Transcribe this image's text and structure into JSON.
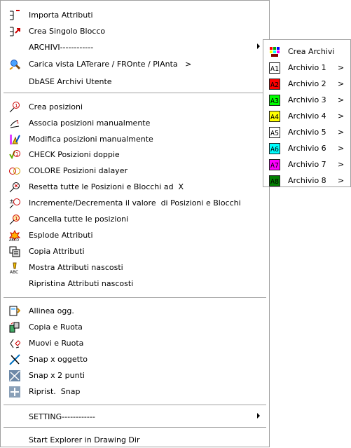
{
  "menu": {
    "items": [
      {
        "label": "Importa Attributi",
        "icon": "import-attributes-icon"
      },
      {
        "label": "Crea Singolo Blocco",
        "icon": "create-block-icon"
      },
      {
        "label": "ARCHIVI------------",
        "submenu": true
      },
      {
        "label": "Carica vista LATerare / FROnte / PIAnta   >",
        "icon": "load-view-icon"
      },
      {
        "label": "DbASE Archivi Utente"
      },
      {
        "label": "Crea posizioni",
        "icon": "create-positions-icon"
      },
      {
        "label": "Associa posizioni manualmente",
        "icon": "associate-positions-icon"
      },
      {
        "label": "Modifica posizioni manualmente",
        "icon": "edit-positions-icon"
      },
      {
        "label": "CHECK Posizioni doppie",
        "icon": "check-duplicates-icon"
      },
      {
        "label": "COLORE Posizioni dalayer",
        "icon": "color-positions-icon"
      },
      {
        "label": "Resetta tutte le Posizioni e Blocchi ad  X",
        "icon": "reset-positions-icon"
      },
      {
        "label": "Incremente/Decrementa il valore  di Posizioni e Blocchi",
        "icon": "increment-icon"
      },
      {
        "label": "Cancella tutte le posizioni",
        "icon": "delete-positions-icon"
      },
      {
        "label": "Esplode Attributi",
        "icon": "explode-attributes-icon"
      },
      {
        "label": "Copia Attributi",
        "icon": "copy-attributes-icon"
      },
      {
        "label": "Mostra Attributi nascosti",
        "icon": "show-hidden-attributes-icon"
      },
      {
        "label": "Ripristina Attributi nascosti"
      },
      {
        "label": "Allinea ogg.",
        "icon": "align-objects-icon"
      },
      {
        "label": "Copia e Ruota",
        "icon": "copy-rotate-icon"
      },
      {
        "label": "Muovi e Ruota",
        "icon": "move-rotate-icon"
      },
      {
        "label": "Snap x oggetto",
        "icon": "snap-object-icon"
      },
      {
        "label": "Snap x 2 punti",
        "icon": "snap-two-points-icon"
      },
      {
        "label": "Riprist.  Snap",
        "icon": "restore-snap-icon"
      },
      {
        "label": "SETTING------------",
        "submenu": true
      },
      {
        "label": "Start Explorer in Drawing Dir"
      }
    ]
  },
  "submenu": {
    "items": [
      {
        "label": "Crea Archivi",
        "icon": "create-archives-icon"
      },
      {
        "label": "Archivio 1",
        "arrow": ">",
        "swatch": "#ffffff",
        "glyph": "A1"
      },
      {
        "label": "Archivio 2",
        "arrow": ">",
        "swatch": "#ff0000",
        "glyph": "A2"
      },
      {
        "label": "Archivio 3",
        "arrow": ">",
        "swatch": "#00ff00",
        "glyph": "A3"
      },
      {
        "label": "Archivio 4",
        "arrow": ">",
        "swatch": "#ffff00",
        "glyph": "A4"
      },
      {
        "label": "Archivio 5",
        "arrow": ">",
        "swatch": "#ffffff",
        "glyph": "A5"
      },
      {
        "label": "Archivio 6",
        "arrow": ">",
        "swatch": "#00ffff",
        "glyph": "A6"
      },
      {
        "label": "Archivio 7",
        "arrow": ">",
        "swatch": "#ff00ff",
        "glyph": "A7"
      },
      {
        "label": "Archivio 8",
        "arrow": ">",
        "swatch": "#007f00",
        "glyph": "A8"
      }
    ]
  }
}
